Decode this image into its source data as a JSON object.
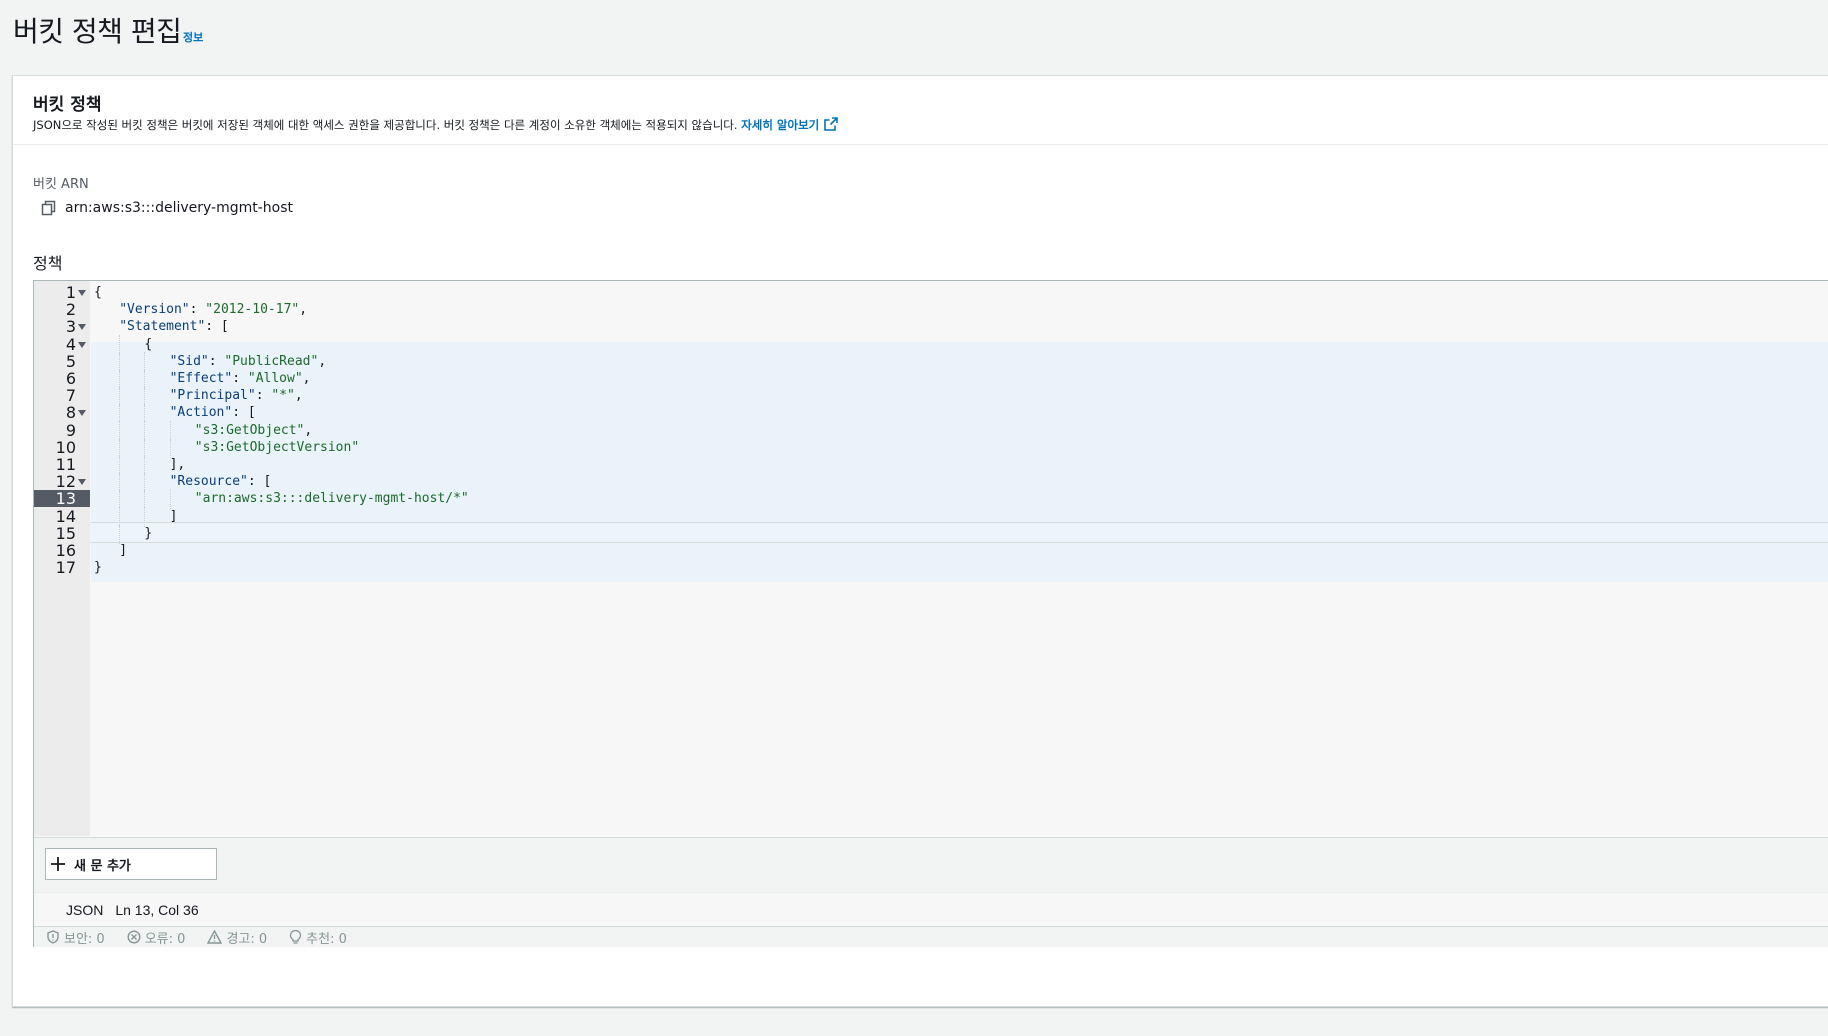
{
  "header": {
    "title": "버킷 정책 편집",
    "info_link": "정보"
  },
  "panel": {
    "title": "버킷 정책",
    "description": "JSON으로 작성된 버킷 정책은 버킷에 저장된 객체에 대한 액세스 권한을 제공합니다. 버킷 정책은 다른 계정이 소유한 객체에는 적용되지 않습니다.",
    "learn_more": "자세히 알아보기",
    "arn_label": "버킷 ARN",
    "arn_value": "arn:aws:s3:::delivery-mgmt-host",
    "policy_label": "정책"
  },
  "editor": {
    "lines": [
      {
        "n": "1",
        "text": "{"
      },
      {
        "n": "2",
        "text": "    \"Version\": \"2012-10-17\","
      },
      {
        "n": "3",
        "text": "    \"Statement\": ["
      },
      {
        "n": "4",
        "text": "        {"
      },
      {
        "n": "5",
        "text": "            \"Sid\": \"PublicRead\","
      },
      {
        "n": "6",
        "text": "            \"Effect\": \"Allow\","
      },
      {
        "n": "7",
        "text": "            \"Principal\": \"*\","
      },
      {
        "n": "8",
        "text": "            \"Action\": ["
      },
      {
        "n": "9",
        "text": "                \"s3:GetObject\","
      },
      {
        "n": "10",
        "text": "                \"s3:GetObjectVersion\""
      },
      {
        "n": "11",
        "text": "            ],"
      },
      {
        "n": "12",
        "text": "            \"Resource\": ["
      },
      {
        "n": "13",
        "text": "                \"arn:aws:s3:::delivery-mgmt-host/*\""
      },
      {
        "n": "14",
        "text": "            ]"
      },
      {
        "n": "15",
        "text": "        }"
      },
      {
        "n": "16",
        "text": "    ]"
      },
      {
        "n": "17",
        "text": "}"
      }
    ],
    "active_line": "13",
    "add_statement": "새 문 추가",
    "language": "JSON",
    "cursor": "Ln 13, Col 36",
    "diagnostics": {
      "security": "보안: 0",
      "errors": "오류: 0",
      "warnings": "경고: 0",
      "suggestions": "추천: 0"
    }
  },
  "colors": {
    "link": "#0073bb",
    "active_gutter": "#545b64",
    "json_key": "#0a3f7a",
    "json_string": "#1d6a2c"
  }
}
